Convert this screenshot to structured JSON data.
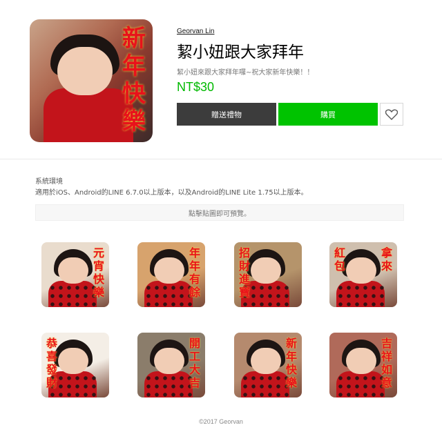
{
  "product": {
    "author": "Georvan Lin",
    "title": "絜小妞跟大家拜年",
    "description": "絜小妞來跟大家拜年囉~祝大家新年快樂！！",
    "price": "NT$30",
    "main_image_calligraphy": "新年快樂"
  },
  "actions": {
    "gift_label": "贈送禮物",
    "buy_label": "購買",
    "favorite_icon": "heart-icon"
  },
  "environment": {
    "label": "系統環境",
    "text": "適用於iOS、Android的LINE 6.7.0以上版本，以及Android的LINE Lite 1.75以上版本。"
  },
  "preview": {
    "label": "點擊貼圖即可預覽。"
  },
  "stickers": [
    {
      "left": "",
      "right": "元宵快樂",
      "bg": "#e9dccd"
    },
    {
      "left": "",
      "right": "年年有餘",
      "bg": "#d7a36d"
    },
    {
      "left": "招財進寶",
      "right": "",
      "bg": "#b5946b"
    },
    {
      "left": "紅包",
      "right": "拿來",
      "bg": "#cfbfae"
    },
    {
      "left": "恭喜發財",
      "right": "",
      "bg": "#f4eee6"
    },
    {
      "left": "",
      "right": "開工大吉",
      "bg": "#8b7d6b"
    },
    {
      "left": "",
      "right": "新年快樂",
      "bg": "#b58a6e"
    },
    {
      "left": "",
      "right": "吉祥如意",
      "bg": "#b06a5a"
    }
  ],
  "footer": "©2017 Georvan",
  "colors": {
    "price_green": "#00b900",
    "buy_green": "#00c300",
    "gift_dark": "#3c3c3c",
    "calligraphy_red": "#e8121b"
  }
}
